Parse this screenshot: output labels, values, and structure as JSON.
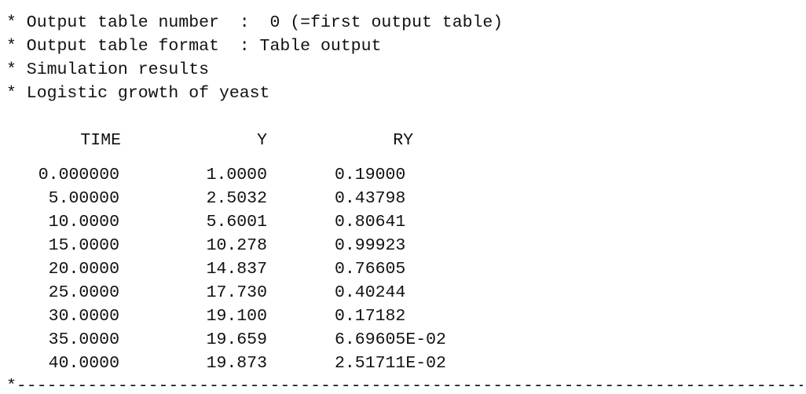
{
  "rules": {
    "top": "*--------------------------------------------------------------------------------",
    "bottom": "*--------------------------------------------------------------------------------"
  },
  "header_lines": [
    "* Output table number  :  0 (=first output table)",
    "* Output table format  : Table output",
    "* Simulation results",
    "* Logistic growth of yeast"
  ],
  "table": {
    "columns": [
      "TIME",
      "Y",
      "RY"
    ],
    "rows": [
      [
        "0.000000",
        "1.0000",
        "0.19000"
      ],
      [
        "5.00000",
        "2.5032",
        "0.43798"
      ],
      [
        "10.0000",
        "5.6001",
        "0.80641"
      ],
      [
        "15.0000",
        "10.278",
        "0.99923"
      ],
      [
        "20.0000",
        "14.837",
        "0.76605"
      ],
      [
        "25.0000",
        "17.730",
        "0.40244"
      ],
      [
        "30.0000",
        "19.100",
        "0.17182"
      ],
      [
        "35.0000",
        "19.659",
        "6.69605E-02"
      ],
      [
        "40.0000",
        "19.873",
        "2.51711E-02"
      ]
    ]
  }
}
